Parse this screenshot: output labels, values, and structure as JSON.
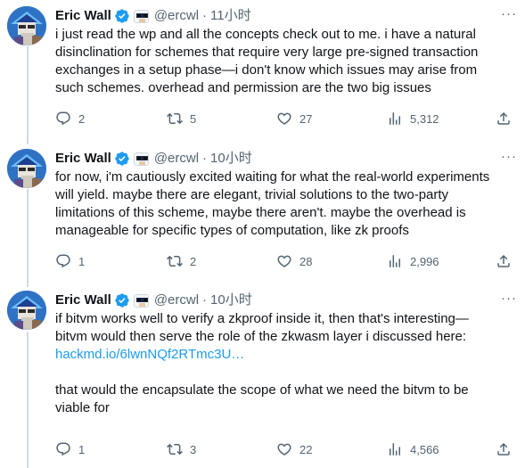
{
  "tweets": [
    {
      "author_name": "Eric Wall",
      "handle": "@ercwl",
      "separator": "·",
      "time": "11小时",
      "more_label": "···",
      "lines": [
        "i just read the wp and all the concepts check out to me. i have a natural",
        "disinclination for schemes that require very large pre-signed transaction",
        "exchanges in a setup phase—i don't know which issues may arise from",
        "such schemes. overhead and permission are the two big issues"
      ],
      "replies": "2",
      "reposts": "5",
      "likes": "27",
      "views": "5,312"
    },
    {
      "author_name": "Eric Wall",
      "handle": "@ercwl",
      "separator": "·",
      "time": "10小时",
      "more_label": "···",
      "lines": [
        "for now, i'm cautiously excited waiting for what the real-world experiments",
        "will yield. maybe there are elegant, trivial solutions to the two-party",
        "limitations of this scheme, maybe there aren't. maybe the overhead is",
        "manageable for specific types of computation, like zk proofs"
      ],
      "replies": "1",
      "reposts": "2",
      "likes": "28",
      "views": "2,996"
    },
    {
      "author_name": "Eric Wall",
      "handle": "@ercwl",
      "separator": "·",
      "time": "10小时",
      "more_label": "···",
      "lines": [
        "if bitvm works well to verify a zkproof inside it, then that's interesting—",
        "bitvm would then serve the role of the zkwasm layer i discussed here:"
      ],
      "link": "hackmd.io/6lwnNQf2RTmc3U…",
      "lines_after": [
        "that would the encapsulate the scope of what we need the bitvm to be",
        "viable for"
      ],
      "replies": "1",
      "reposts": "3",
      "likes": "22",
      "views": "4,566"
    }
  ],
  "colors": {
    "text": "#0f1419",
    "muted": "#536471",
    "link": "#1d9bf0",
    "verified": "#1d9bf0",
    "thread_line": "#cfd9de"
  },
  "icons": [
    "verified-badge-icon",
    "affiliate-badge-icon",
    "reply-icon",
    "repost-icon",
    "like-icon",
    "views-icon",
    "share-icon",
    "more-icon"
  ]
}
